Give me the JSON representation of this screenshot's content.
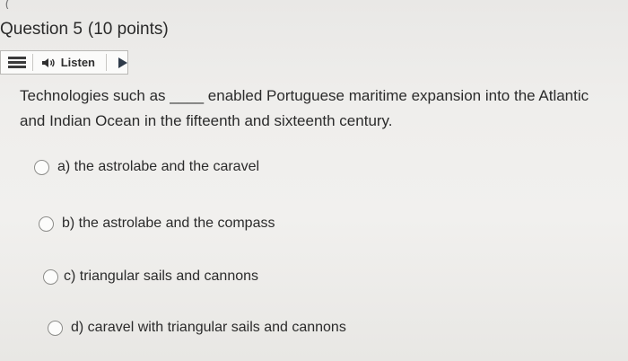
{
  "top_mark": "(",
  "question": {
    "name": "Question 5",
    "points": "(10 points)"
  },
  "toolbar": {
    "menu_icon": "menu-icon",
    "speaker_icon": "speaker-icon",
    "listen_label": "Listen",
    "play_icon": "play-icon"
  },
  "prompt": {
    "line1": "Technologies such as ____ enabled Portuguese maritime expansion into the Atlantic",
    "line2": "and Indian Ocean in the fifteenth and sixteenth century."
  },
  "options": [
    {
      "label": "a) the astrolabe and the caravel"
    },
    {
      "label": "b) the astrolabe and the compass"
    },
    {
      "label": "c) triangular sails and cannons"
    },
    {
      "label": "d) caravel with triangular sails and cannons"
    }
  ]
}
